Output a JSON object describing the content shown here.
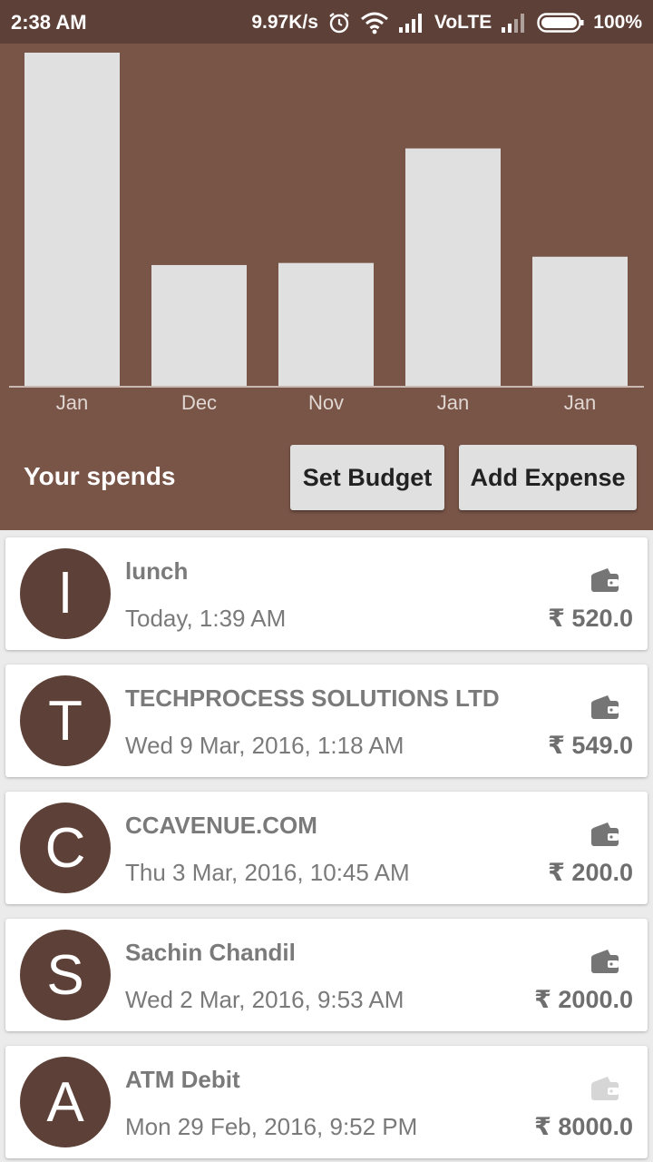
{
  "status_bar": {
    "time": "2:38 AM",
    "speed": "9.97K/s",
    "network": "VoLTE",
    "battery": "100%"
  },
  "chart_data": {
    "type": "bar",
    "categories": [
      "Jan",
      "Dec",
      "Nov",
      "Jan",
      "Jan"
    ],
    "values": [
      8000,
      2900,
      2950,
      5700,
      3100
    ],
    "bar_color": "#e0e0e0"
  },
  "header": {
    "label": "Your spends",
    "set_budget_label": "Set Budget",
    "add_expense_label": "Add Expense"
  },
  "colors": {
    "header_bg": "#795548",
    "status_bg": "#5d4037",
    "avatar_bg": "#5d4037"
  },
  "transactions": [
    {
      "initial": "l",
      "title": "lunch",
      "date": "Today, 1:39 AM",
      "amount": "₹ 520.0",
      "icon": "wallet-icon"
    },
    {
      "initial": "T",
      "title": "TECHPROCESS SOLUTIONS LTD",
      "date": "Wed 9 Mar, 2016, 1:18 AM",
      "amount": "₹ 549.0",
      "icon": "wallet-icon"
    },
    {
      "initial": "C",
      "title": "CCAVENUE.COM",
      "date": "Thu 3 Mar, 2016, 10:45 AM",
      "amount": "₹ 200.0",
      "icon": "wallet-icon"
    },
    {
      "initial": "S",
      "title": "Sachin Chandil",
      "date": "Wed 2 Mar, 2016, 9:53 AM",
      "amount": "₹ 2000.0",
      "icon": "wallet-icon"
    },
    {
      "initial": "A",
      "title": "ATM Debit",
      "date": "Mon 29 Feb, 2016, 9:52 PM",
      "amount": "₹ 8000.0",
      "icon": "wallet-icon"
    }
  ]
}
